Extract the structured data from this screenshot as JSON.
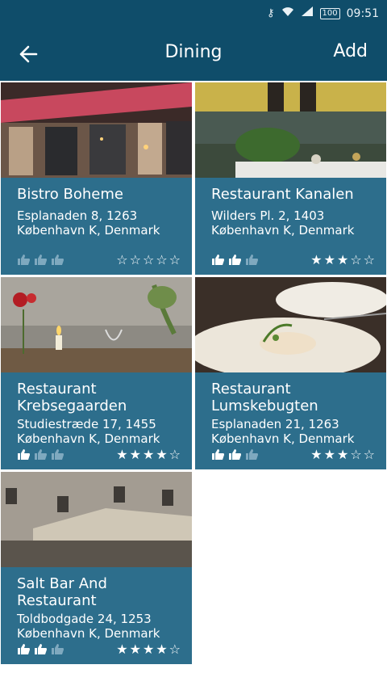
{
  "status": {
    "time": "09:51",
    "battery": "100"
  },
  "header": {
    "title": "Dining",
    "add_label": "Add"
  },
  "restaurants": [
    {
      "name": "Bistro Boheme",
      "address": "Esplanaden 8, 1263",
      "city": "København K, Denmark",
      "price_level": 0,
      "price_max": 3,
      "rating": 0,
      "rating_max": 5
    },
    {
      "name": "Restaurant Kanalen",
      "address": "Wilders Pl. 2, 1403",
      "city": "København K, Denmark",
      "price_level": 2,
      "price_max": 3,
      "rating": 3,
      "rating_max": 5
    },
    {
      "name": "Restaurant Krebsegaarden",
      "address": "Studiestræde 17, 1455",
      "city": "København K, Denmark",
      "price_level": 1,
      "price_max": 3,
      "rating": 4,
      "rating_max": 5
    },
    {
      "name": "Restaurant Lumskebugten",
      "address": "Esplanaden 21, 1263",
      "city": "København K, Denmark",
      "price_level": 2,
      "price_max": 3,
      "rating": 3,
      "rating_max": 5
    },
    {
      "name": "Salt Bar And Restaurant",
      "address": "Toldbodgade 24, 1253",
      "city": "København K, Denmark",
      "price_level": 2,
      "price_max": 3,
      "rating": 4,
      "rating_max": 5
    }
  ],
  "colors": {
    "bar": "#0f4d6a",
    "card": "#2d6e8c",
    "thumb_active": "#ffffff",
    "thumb_inactive": "#7fa9bf"
  }
}
